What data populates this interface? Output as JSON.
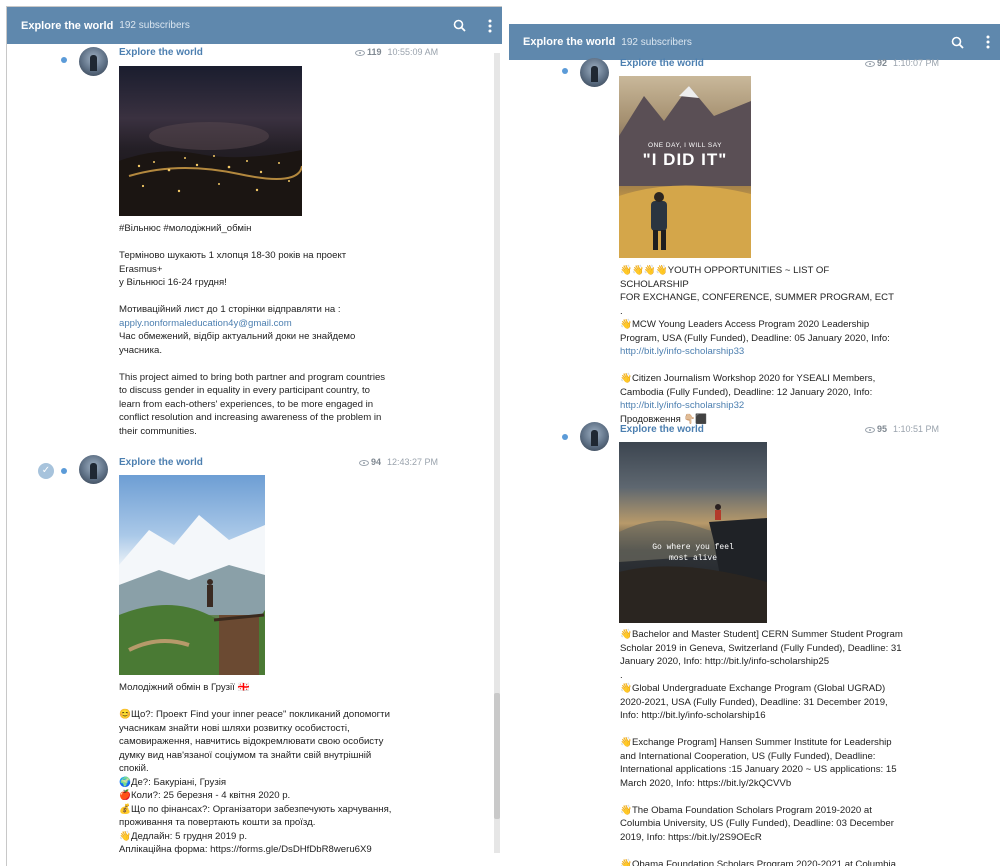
{
  "left": {
    "header": {
      "title": "Explore the world",
      "subscribers": "192 subscribers"
    },
    "msg1": {
      "author": "Explore the world",
      "views": "119",
      "time": "10:55:09 AM",
      "lines": [
        "#Вільнюс #молодіжний_обмін",
        "",
        "Терміново шукають 1 хлопця 18-30 років на проект Erasmus+",
        "у Вільнюсі 16-24 грудня!",
        "",
        "Мотиваційний лист до 1 сторінки відправляти на :",
        "apply.nonformaleducation4y@gmail.com",
        "Час обмежений, відбір актуальний доки не знайдемо",
        "учасника.",
        "",
        "This project aimed to bring both partner and program countries",
        "to discuss gender in equality in every participant country, to",
        "learn from each-others' experiences, to be more engaged in",
        "conflict resolution and increasing awareness of the problem in",
        "their communities."
      ]
    },
    "msg2": {
      "author": "Explore the world",
      "views": "94",
      "time": "12:43:27 PM",
      "lines": [
        "Молодіжний обмін в Грузії 🇬🇪",
        "",
        "😊Що?: Проект Find your inner peace\" покликаний допомогти",
        "учасникам знайти нові шляхи розвитку особистості,",
        "самовираження, навчитись відокремлювати свою особисту",
        "думку вид нав'язаної соціумом та знайти свій внутрішній",
        "спокій.",
        "🌍Де?: Бакуріані, Грузія",
        "🍎Коли?: 25 березня - 4 квітня 2020 р.",
        "💰Що по фінансах?: Організатори забезпечують харчування,",
        "проживання та повертають кошти за проїзд.",
        "👋Дедлайн: 5 грудня 2019 р.",
        "Аплікаційна форма: https://forms.gle/DsDHfDbR8weru6X9"
      ]
    }
  },
  "right": {
    "header": {
      "title": "Explore the world",
      "subscribers": "192 subscribers"
    },
    "msg1": {
      "author": "Explore the world",
      "views": "92",
      "time": "1:10:07 PM",
      "image_top": "ONE DAY, I WILL SAY",
      "image_main": "\"I DID IT\"",
      "lines": [
        "👋👋👋👋YOUTH OPPORTUNITIES ~ LIST OF SCHOLARSHIP",
        "FOR EXCHANGE, CONFERENCE, SUMMER PROGRAM, ECT",
        ".",
        "👋MCW Young Leaders Access Program 2020 Leadership",
        "Program, USA (Fully Funded), Deadline: 05 January 2020, Info:",
        "http://bit.ly/info-scholarship33",
        "",
        "👋Citizen Journalism Workshop 2020 for YSEALI Members,",
        "Cambodia (Fully Funded), Deadline: 12 January 2020, Info:",
        "http://bit.ly/info-scholarship32",
        "Продовження 👇🏼⬛"
      ]
    },
    "msg2": {
      "author": "Explore the world",
      "views": "95",
      "time": "1:10:51 PM",
      "image_text": "Go where you feel most alive",
      "lines": [
        "👋Bachelor and Master Student] CERN Summer Student Program",
        "Scholar 2019 in Geneva, Switzerland (Fully Funded), Deadline: 31",
        "January 2020, Info: http://bit.ly/info-scholarship25",
        ".",
        "👋Global Undergraduate Exchange Program (Global UGRAD)",
        "2020-2021, USA (Fully Funded), Deadline: 31 December 2019,",
        "Info: http://bit.ly/info-scholarship16",
        "",
        "👋Exchange Program] Hansen Summer Institute for Leadership",
        "and International Cooperation, US (Fully Funded), Deadline:",
        "International applications :15 January 2020 ~ US applications: 15",
        "March 2020, Info: https://bit.ly/2kQCVVb",
        "",
        "👋The Obama Foundation Scholars Program 2019-2020 at",
        "Columbia University, US (Fully Funded), Deadline: 03 December",
        "2019, Info: https://bit.ly/2S9OEcR",
        "",
        "👋Obama Foundation Scholars Program 2020-2021 at Columbia"
      ]
    }
  }
}
